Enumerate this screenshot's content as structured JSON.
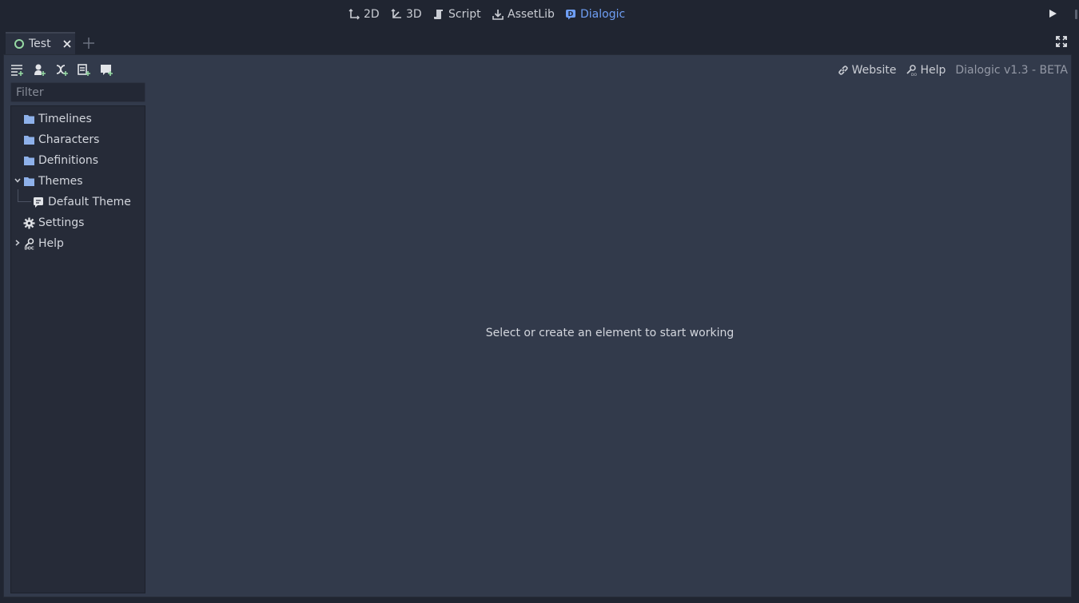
{
  "workspaces": [
    {
      "label": "2D",
      "icon": "2d-move-icon",
      "active": false
    },
    {
      "label": "3D",
      "icon": "3d-move-icon",
      "active": false
    },
    {
      "label": "Script",
      "icon": "script-icon",
      "active": false
    },
    {
      "label": "AssetLib",
      "icon": "download-icon",
      "active": false
    },
    {
      "label": "Dialogic",
      "icon": "dialogic-icon",
      "active": true
    }
  ],
  "scene_tab": {
    "label": "Test"
  },
  "toolbar": {
    "buttons": [
      "add-timeline-icon",
      "add-character-icon",
      "add-definition-icon",
      "add-theme-icon",
      "add-folder-icon"
    ]
  },
  "links": {
    "website": "Website",
    "help": "Help",
    "version": "Dialogic v1.3 - BETA"
  },
  "filter": {
    "placeholder": "Filter",
    "value": ""
  },
  "tree": [
    {
      "label": "Timelines",
      "icon": "folder-icon"
    },
    {
      "label": "Characters",
      "icon": "folder-icon"
    },
    {
      "label": "Definitions",
      "icon": "folder-icon"
    },
    {
      "label": "Themes",
      "icon": "folder-icon",
      "expanded": true
    },
    {
      "label": "Default Theme",
      "icon": "theme-icon"
    },
    {
      "label": "Settings",
      "icon": "gear-icon"
    },
    {
      "label": "Help",
      "icon": "doc-icon",
      "collapsed": true
    }
  ],
  "main": {
    "empty_message": "Select or create an element to start working"
  },
  "colors": {
    "accent": "#6f9ff5",
    "folder": "#8eb1ea",
    "panel": "#323a4b",
    "tree_bg": "#262b38"
  }
}
